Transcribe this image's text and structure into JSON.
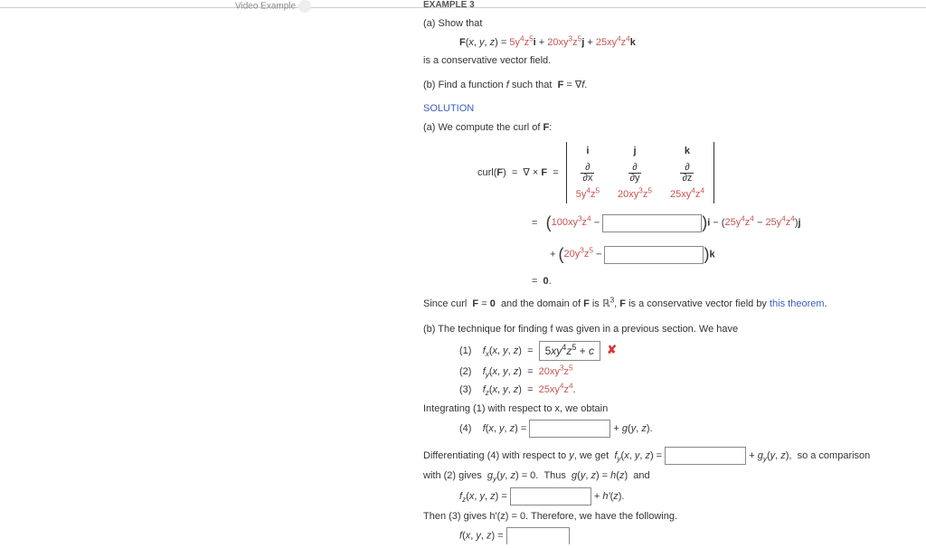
{
  "header": {
    "left_snippet": "Video Example",
    "right_snippet": "EXAMPLE 3"
  },
  "part_a": {
    "prompt": "(a) Show that",
    "field_def": "F(x, y, z) = 5y⁴z⁵i + 20xy³z⁵j + 25xy⁴z⁴k",
    "claim": "is a conservative vector field."
  },
  "part_b": {
    "prompt": "(b) Find a function f such that  F = ∇f."
  },
  "solution_label": "SOLUTION",
  "sol_a_intro": "(a) We compute the curl of F:",
  "curl_label": "curl(F)   =   ∇ × F  =",
  "det": {
    "r1": [
      "i",
      "j",
      "k"
    ],
    "r2_frac": [
      [
        "∂",
        "∂x"
      ],
      [
        "∂",
        "∂y"
      ],
      [
        "∂",
        "∂z"
      ]
    ],
    "r3": [
      "5y⁴z⁵",
      "20xy³z⁵",
      "25xy⁴z⁴"
    ]
  },
  "curl_i": {
    "pre": "=   (",
    "left": "100xy³z⁴ − ",
    "post": ")i − (25y⁴z⁴ − 25y⁴z⁴)j"
  },
  "curl_k": {
    "pre": "   + (",
    "left": "20y³z⁵ − ",
    "post": ")k"
  },
  "curl_zero": "=  0.",
  "conserv_text_1": "Since curl  F = 0  and the domain of F is ",
  "conserv_Rn": "ℝ³",
  "conserv_text_2": ", F is a conservative vector field by ",
  "theorem_link": "this theorem",
  "sol_b_intro": "(b) The technique for finding f was given in a previous section. We have",
  "eq1": {
    "num": "(1)",
    "lhs": "fₓ(x, y, z)  =",
    "answer": "5xy⁴z⁵ + c",
    "mark": "✘"
  },
  "eq2": {
    "num": "(2)",
    "text": "f_y(x, y, z)  =  20xy³z⁵"
  },
  "eq3": {
    "num": "(3)",
    "text": "f_z(x, y, z)  =  25xy⁴z⁴."
  },
  "integrate_text": "Integrating (1) with respect to x, we obtain",
  "eq4": {
    "num": "(4)",
    "lhs": "f(x, y, z) =",
    "tail": " + g(y, z)."
  },
  "diff_text_1": "Differentiating (4) with respect to y, we get  f_y(x, y, z) = ",
  "diff_text_2": " + g_y(y, z),  so a comparison",
  "with2_text": "with (2) gives  g_y(y, z) = 0.  Thus  g(y, z) = h(z)  and",
  "fz_line": {
    "lhs": "f_z(x, y, z) =",
    "tail": " + h'(z)."
  },
  "then3": "Then (3) gives  h'(z) = 0.  Therefore, we have the following.",
  "final": {
    "lhs": "f(x, y, z) ="
  }
}
